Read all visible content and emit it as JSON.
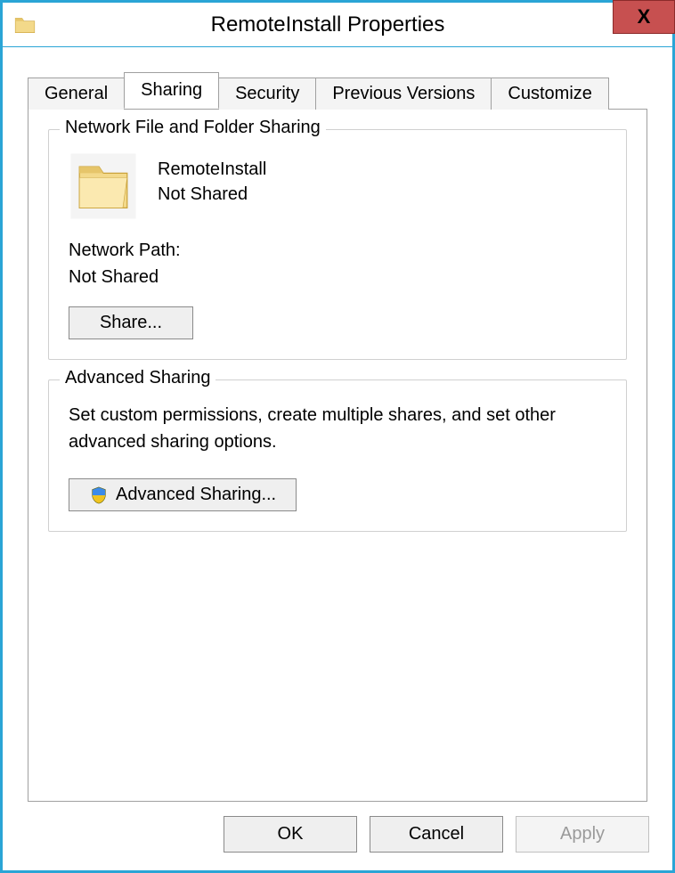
{
  "window": {
    "title": "RemoteInstall Properties"
  },
  "tabs": {
    "general": "General",
    "sharing": "Sharing",
    "security": "Security",
    "previous": "Previous Versions",
    "customize": "Customize",
    "active": "sharing"
  },
  "networkSharing": {
    "groupTitle": "Network File and Folder Sharing",
    "folderName": "RemoteInstall",
    "shareStatus": "Not Shared",
    "networkPathLabel": "Network Path:",
    "networkPathValue": "Not Shared",
    "shareButton": "Share..."
  },
  "advancedSharing": {
    "groupTitle": "Advanced Sharing",
    "description": "Set custom permissions, create multiple shares, and set other advanced sharing options.",
    "button": "Advanced Sharing..."
  },
  "footer": {
    "ok": "OK",
    "cancel": "Cancel",
    "apply": "Apply"
  }
}
